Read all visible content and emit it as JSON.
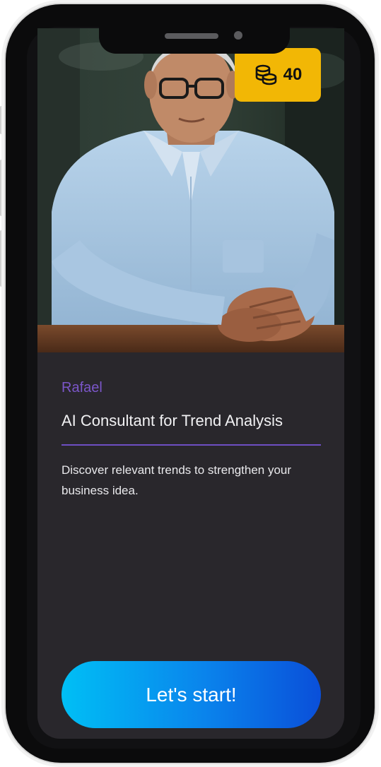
{
  "coin_badge": {
    "icon": "coins-stack-icon",
    "count": "40",
    "color": "#f2b705"
  },
  "consultant": {
    "name": "Rafael",
    "role": "AI Consultant for Trend Analysis",
    "description": "Discover relevant trends to strengthen your business idea."
  },
  "actions": {
    "start_label": "Let's start!"
  },
  "colors": {
    "accent_purple": "#7b56c9",
    "card_background": "#29272c",
    "button_gradient_start": "#00bff5",
    "button_gradient_end": "#0a4fd9"
  }
}
